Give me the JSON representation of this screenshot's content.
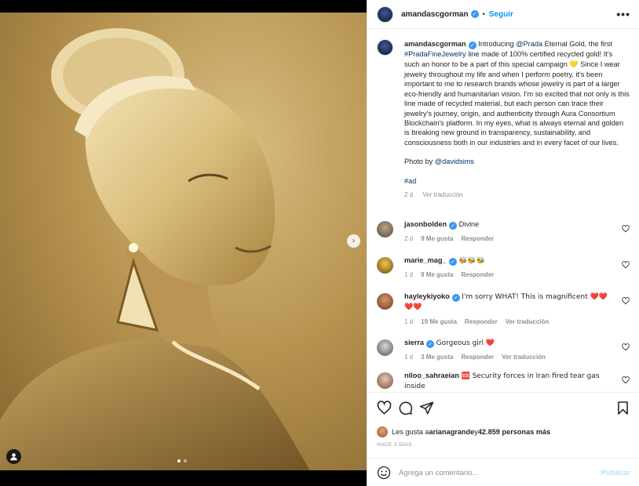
{
  "header": {
    "username": "amandascgorman",
    "separator": "•",
    "follow_label": "Seguir",
    "more_label": "•••"
  },
  "caption": {
    "username": "amandascgorman",
    "parts": {
      "p1": "Introducing ",
      "mention1": "@Prada",
      "p2": " Eternal Gold, the first ",
      "hashtag1": "#PradaFineJewelry",
      "p3": " line made of 100% certified recycled gold! It's such an honor to be a part of this special campaign ",
      "emoji1": "💛",
      "p4": " Since I wear jewelry throughout my life and when I perform poetry, it's been important to me to research brands whose jewelry is part of a larger eco-friendly and humanitarian vision. I'm so excited that not only is this line made of recycled material, but each person can trace their jewelry's journey, origin, and authenticity through Aura Consortium Blockchain's platform. In my eyes, what is always eternal and golden is breaking new ground in transparency, sustainability, and consciousness both in our industries and in every facet of our lives.",
      "photo_by": "Photo by ",
      "mention2": "@davidsims",
      "hashtag2": "#ad"
    },
    "time": "2 d",
    "translate": "Ver traducción"
  },
  "comments": [
    {
      "username": "jasonbolden",
      "text": "Divine",
      "time": "2 d",
      "likes": "9 Me gusta",
      "reply": "Responder",
      "translate": "",
      "avatar_color": "#7a6a58"
    },
    {
      "username": "marie_mag_",
      "text": "🐝🐝🐝",
      "time": "1 d",
      "likes": "9 Me gusta",
      "reply": "Responder",
      "translate": "",
      "avatar_color": "#d4a72c"
    },
    {
      "username": "hayleykiyoko",
      "text": "I'm sorry WHAT! This is magnificent ❤️❤️❤️❤️",
      "time": "1 d",
      "likes": "19 Me gusta",
      "reply": "Responder",
      "translate": "Ver traducción",
      "avatar_color": "#b87b55"
    },
    {
      "username": "sierra",
      "text": "Gorgeous girl ❤️",
      "time": "1 d",
      "likes": "3 Me gusta",
      "reply": "Responder",
      "translate": "Ver traducción",
      "avatar_color": "#9a9a9a"
    },
    {
      "username": "niloo_sahraeian",
      "text": "🆘 Security forces in Iran fired tear gas inside",
      "time": "",
      "likes": "",
      "reply": "",
      "translate": "",
      "avatar_color": "#c9a08a"
    }
  ],
  "likes": {
    "prefix": "Les gusta a ",
    "user": "arianagrande",
    "middle": " y ",
    "count": "42.859 personas más"
  },
  "posted_ago": "HACE 2 DÍAS",
  "comment_box": {
    "placeholder": "Agrega un comentario...",
    "post_label": "Publicar"
  },
  "media": {
    "carousel_total": 2,
    "carousel_current": 1
  },
  "colors": {
    "link": "#00376b",
    "follow": "#0095f6",
    "post_disabled": "#b2dffc",
    "verified": "#3897f0"
  }
}
